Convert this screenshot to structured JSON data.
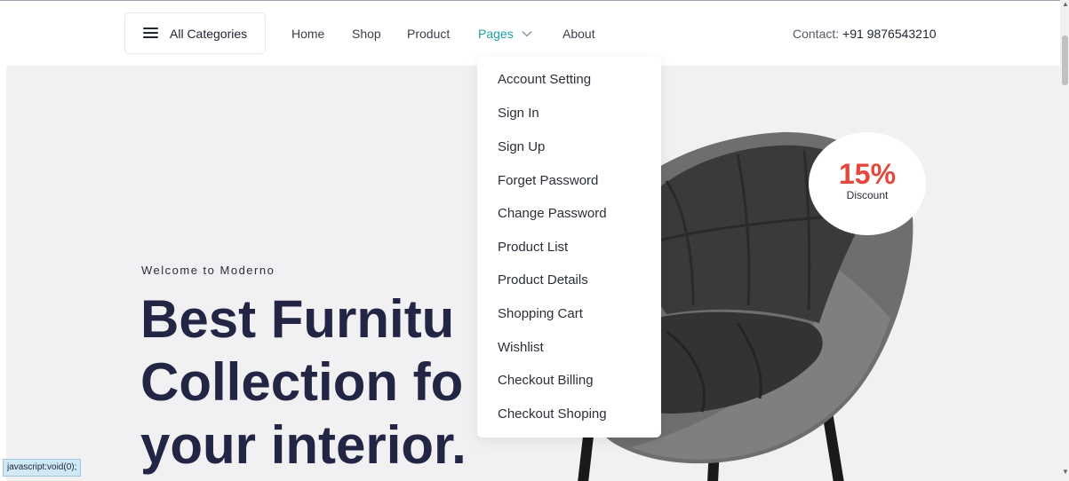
{
  "header": {
    "categories_label": "All Categories",
    "nav": [
      "Home",
      "Shop",
      "Product",
      "Pages",
      "About"
    ],
    "active_nav": "Pages",
    "contact_label": "Contact:",
    "contact_phone": "+91 9876543210"
  },
  "hero": {
    "welcome": "Welcome to Moderno",
    "headline_lines": [
      "Best Furnitu",
      "Collection fo",
      "your interior."
    ],
    "badge_percent": "15%",
    "badge_label": "Discount"
  },
  "pages_menu": {
    "items": [
      "Account Setting",
      "Sign In",
      "Sign Up",
      "Forget Password",
      "Change Password",
      "Product List",
      "Product Details",
      "Shopping Cart",
      "Wishlist",
      "Checkout Billing",
      "Checkout Shoping"
    ]
  },
  "status_bar": "javascript:void(0);",
  "colors": {
    "accent": "#1aa3a3",
    "discount": "#e5483f",
    "headline": "#222544",
    "hero_bg": "#f1f1f3"
  }
}
